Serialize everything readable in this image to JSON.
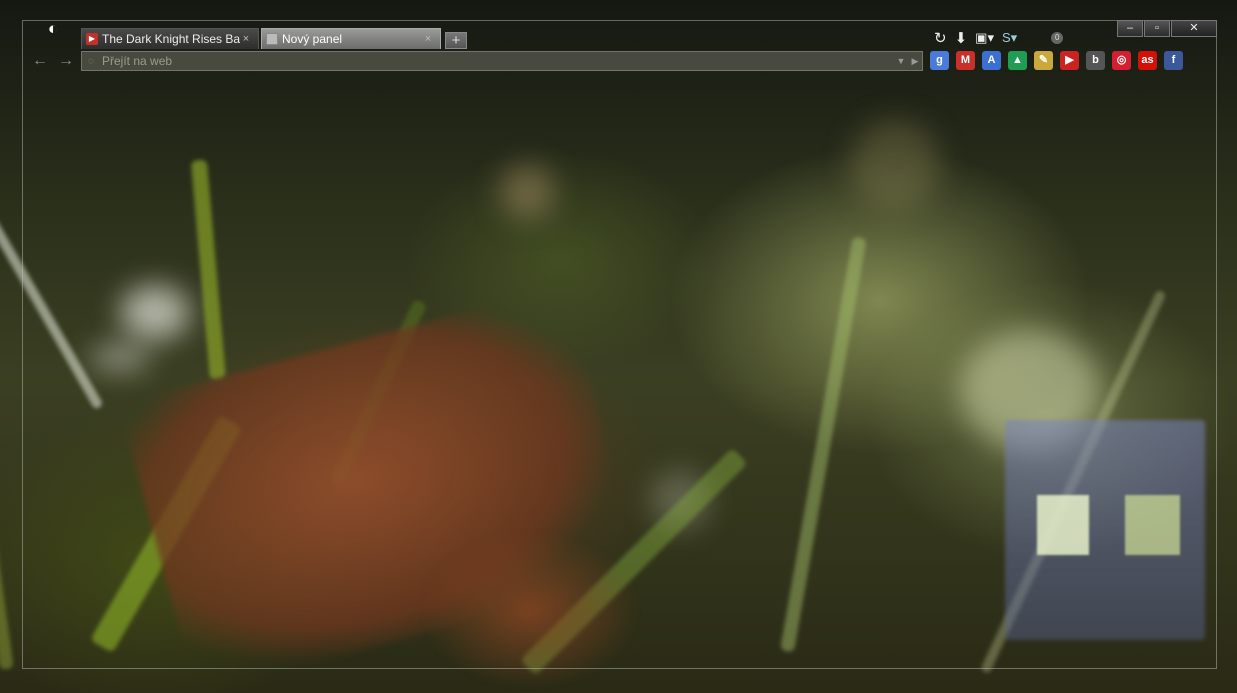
{
  "app": {
    "menu_icon": "opera-logo-icon"
  },
  "tabs": [
    {
      "title": "The Dark Knight Rises Bac...",
      "favicon": "youtube-icon",
      "active": false,
      "close": "×"
    },
    {
      "title": "Nový panel",
      "favicon": "blank-page-icon",
      "active": true,
      "close": "×"
    }
  ],
  "new_tab_label": "+",
  "window_controls": {
    "minimize": "–",
    "maximize": "▫",
    "close": "✕"
  },
  "toolbar_icons": {
    "sync": "↻",
    "download": "⬇",
    "screenshot": "▣▾",
    "skype": "S▾",
    "notifications_count": "0"
  },
  "nav": {
    "back": "←",
    "forward": "→"
  },
  "omnibox": {
    "placeholder": "Přejít na web",
    "dropdown": "▼",
    "go": "▶"
  },
  "bookmarks": [
    {
      "name": "google-search-icon",
      "label": "g",
      "color": "#4a7bd8"
    },
    {
      "name": "gmail-icon",
      "label": "M",
      "color": "#c9302c"
    },
    {
      "name": "translate-icon",
      "label": "A",
      "color": "#3b6fd1"
    },
    {
      "name": "google-drive-icon",
      "label": "▲",
      "color": "#1f9d55"
    },
    {
      "name": "notes-icon",
      "label": "✎",
      "color": "#c9a93b"
    },
    {
      "name": "youtube-icon",
      "label": "▶",
      "color": "#cc2222"
    },
    {
      "name": "bookmark-b-icon",
      "label": "b",
      "color": "#555"
    },
    {
      "name": "target-icon",
      "label": "◎",
      "color": "#d32030"
    },
    {
      "name": "lastfm-icon",
      "label": "as",
      "color": "#d51007"
    },
    {
      "name": "facebook-icon",
      "label": "f",
      "color": "#3b5998"
    }
  ]
}
